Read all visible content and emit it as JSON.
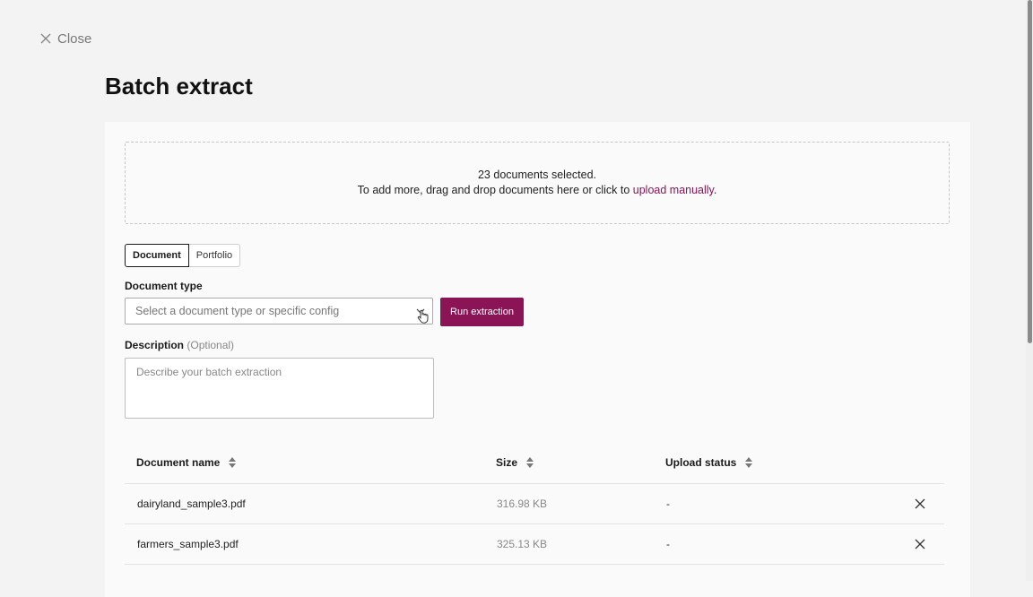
{
  "header": {
    "close_label": "Close",
    "title": "Batch extract"
  },
  "dropzone": {
    "selected_text": "23 documents selected.",
    "instructions": "To add more, drag and drop documents here or click to ",
    "upload_link": "upload manually",
    "trailing": "."
  },
  "mode_toggle": {
    "options": [
      "Document",
      "Portfolio"
    ],
    "selected": "Document"
  },
  "document_type": {
    "label": "Document type",
    "placeholder": "Select a document type or specific config"
  },
  "run_button": {
    "label": "Run extraction"
  },
  "description": {
    "label": "Description",
    "optional": "(Optional)",
    "placeholder": "Describe your batch extraction"
  },
  "table": {
    "columns": [
      "Document name",
      "Size",
      "Upload status"
    ],
    "rows": [
      {
        "name": "dairyland_sample3.pdf",
        "size": "316.98 KB",
        "status": "-"
      },
      {
        "name": "farmers_sample3.pdf",
        "size": "325.13 KB",
        "status": "-"
      }
    ]
  },
  "colors": {
    "accent": "#8b1456",
    "background": "#f3f3f3",
    "panel": "#fafafa"
  }
}
